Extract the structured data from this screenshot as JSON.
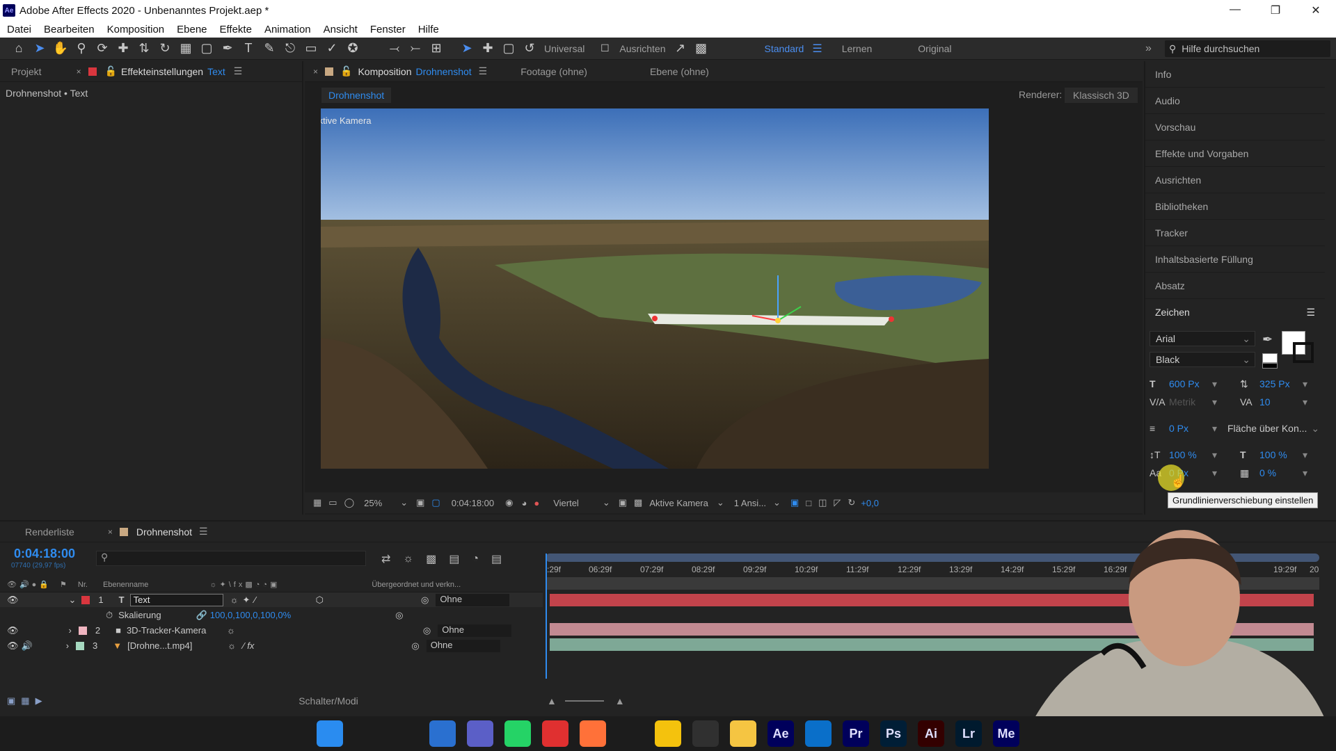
{
  "window": {
    "title": "Adobe After Effects 2020 - Unbenanntes Projekt.aep *",
    "logo": "Ae"
  },
  "menu": [
    "Datei",
    "Bearbeiten",
    "Komposition",
    "Ebene",
    "Effekte",
    "Animation",
    "Ansicht",
    "Fenster",
    "Hilfe"
  ],
  "toolbar": {
    "universal_label": "Universal",
    "ausrichten_label": "Ausrichten",
    "workspaces": [
      "Standard",
      "Lernen",
      "Original"
    ],
    "search_placeholder": "Hilfe durchsuchen"
  },
  "left_panel": {
    "tab_projekt": "Projekt",
    "tab_effekt": "Effekteinstellungen",
    "tab_effekt_target": "Text",
    "breadcrumb": "Drohnenshot • Text"
  },
  "comp_panel": {
    "tab_komposition": "Komposition",
    "tab_comp_name": "Drohnenshot",
    "tab_footage": "Footage (ohne)",
    "tab_ebene": "Ebene (ohne)",
    "subtab": "Drohnenshot",
    "renderer_label": "Renderer:",
    "renderer_value": "Klassisch 3D",
    "active_camera_label": "Aktive Kamera",
    "overlay_text": "Text",
    "footer": {
      "zoom": "25%",
      "timecode": "0:04:18:00",
      "resolution": "Viertel",
      "camera": "Aktive Kamera",
      "views": "1 Ansi...",
      "exposure": "+0,0"
    }
  },
  "right_panel": {
    "items": [
      "Info",
      "Audio",
      "Vorschau",
      "Effekte und Vorgaben",
      "Ausrichten",
      "Bibliotheken",
      "Tracker",
      "Inhaltsbasierte Füllung",
      "Absatz"
    ],
    "zeichen": {
      "title": "Zeichen",
      "font": "Arial",
      "style": "Black",
      "font_size": "600 Px",
      "leading": "325 Px",
      "kerning": "Metrik",
      "tracking": "10",
      "stroke_width": "0 Px",
      "stroke_mode": "Fläche über Kon...",
      "vscale": "100 %",
      "hscale": "100 %",
      "baseline": "0 Px",
      "tsume": "0 %",
      "tooltip": "Grundlinienverschiebung einstellen"
    }
  },
  "timeline": {
    "tab_render": "Renderliste",
    "tab_comp": "Drohnenshot",
    "timecode": "0:04:18:00",
    "timecode_sub": "07740 (29,97 fps)",
    "col_nr": "Nr.",
    "col_name": "Ebenenname",
    "col_parent": "Übergeordnet und verkn...",
    "ruler": [
      ":29f",
      "06:29f",
      "07:29f",
      "08:29f",
      "09:29f",
      "10:29f",
      "11:29f",
      "12:29f",
      "13:29f",
      "14:29f",
      "15:29f",
      "16:29f",
      "19:29f",
      "20"
    ],
    "layers": [
      {
        "nr": "1",
        "type": "T",
        "name": "Text",
        "parent": "Ohne",
        "color": "#d9363e"
      },
      {
        "nr": "2",
        "type": "cam",
        "name": "3D-Tracker-Kamera",
        "parent": "Ohne",
        "color": "#f0b5c0"
      },
      {
        "nr": "3",
        "type": "vid",
        "name": "[Drohne...t.mp4]",
        "parent": "Ohne",
        "color": "#a6d9c0"
      }
    ],
    "prop": {
      "name": "Skalierung",
      "value": "100,0,100,0,100,0%"
    },
    "footer_label": "Schalter/Modi"
  },
  "taskbar": {
    "apps": [
      {
        "name": "windows",
        "label": "",
        "bg": "#2a8cf0"
      },
      {
        "name": "search",
        "label": "",
        "bg": "transparent"
      },
      {
        "name": "taskview",
        "label": "",
        "bg": "transparent"
      },
      {
        "name": "widgets",
        "label": "",
        "bg": "#2a70d0"
      },
      {
        "name": "teams",
        "label": "",
        "bg": "#5b5fc7"
      },
      {
        "name": "whatsapp",
        "label": "",
        "bg": "#25d366"
      },
      {
        "name": "screenrec",
        "label": "",
        "bg": "#e03030"
      },
      {
        "name": "firefox",
        "label": "",
        "bg": "#ff7139"
      },
      {
        "name": "tool",
        "label": "",
        "bg": "transparent"
      },
      {
        "name": "chrome",
        "label": "",
        "bg": "#f4c20d"
      },
      {
        "name": "obs",
        "label": "",
        "bg": "#303030"
      },
      {
        "name": "explorer",
        "label": "",
        "bg": "#f5c542"
      },
      {
        "name": "aftereffects",
        "label": "Ae",
        "bg": "#00005b"
      },
      {
        "name": "vscode",
        "label": "",
        "bg": "#0a6fc9"
      },
      {
        "name": "premiere",
        "label": "Pr",
        "bg": "#00005b"
      },
      {
        "name": "photoshop",
        "label": "Ps",
        "bg": "#001e36"
      },
      {
        "name": "illustrator",
        "label": "Ai",
        "bg": "#330000"
      },
      {
        "name": "lightroom",
        "label": "Lr",
        "bg": "#001a2e"
      },
      {
        "name": "mediaencoder",
        "label": "Me",
        "bg": "#00005b"
      }
    ]
  }
}
